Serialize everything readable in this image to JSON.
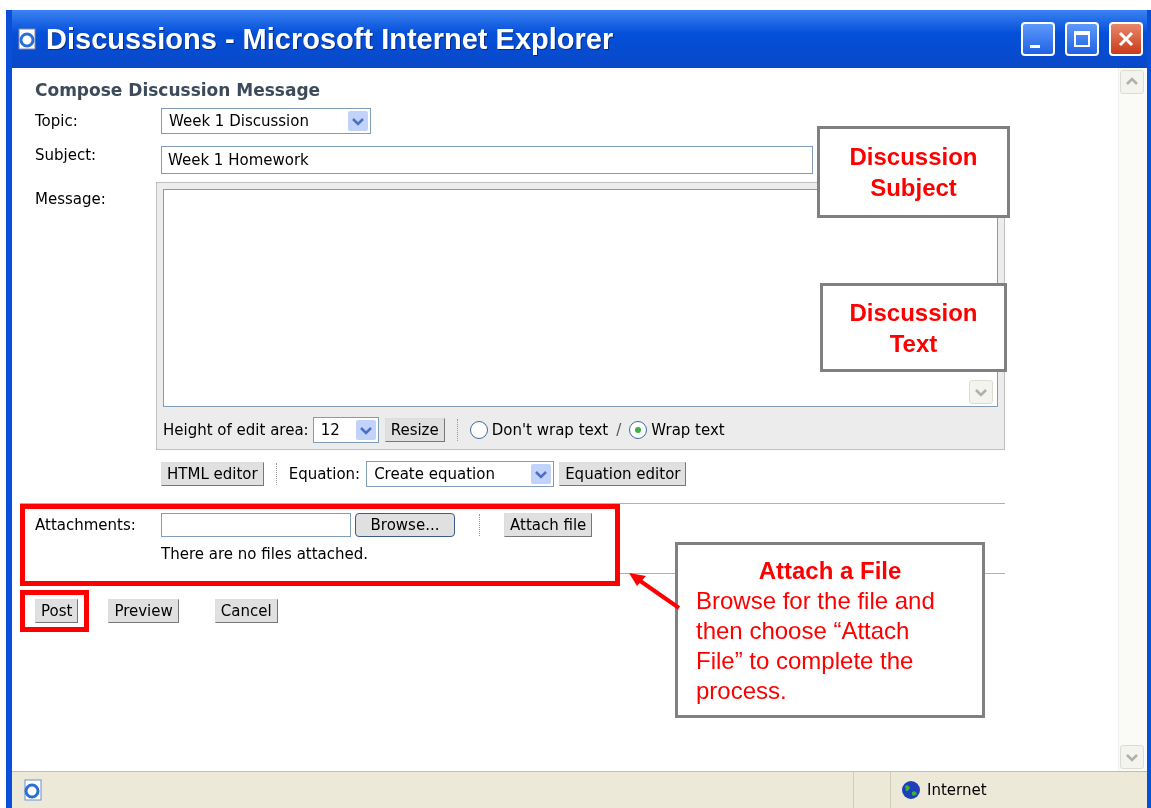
{
  "window": {
    "title": "Discussions - Microsoft Internet Explorer"
  },
  "form": {
    "heading": "Compose Discussion Message",
    "topic": {
      "label": "Topic:",
      "value": "Week 1 Discussion"
    },
    "subject": {
      "label": "Subject:",
      "value": "Week 1 Homework"
    },
    "message": {
      "label": "Message:"
    },
    "editor": {
      "height_label": "Height of edit area:",
      "height_value": "12",
      "resize": "Resize",
      "separator": "/",
      "wrap_options": [
        {
          "label": "Don't wrap text",
          "selected": false
        },
        {
          "label": "Wrap text",
          "selected": true
        }
      ]
    },
    "html_editor": "HTML editor",
    "equation": {
      "label": "Equation:",
      "value": "Create equation",
      "editor": "Equation editor"
    },
    "attachments": {
      "label": "Attachments:",
      "browse": "Browse...",
      "attach": "Attach file",
      "note": "There are no files attached.",
      "highlighted": true
    },
    "buttons": [
      {
        "label": "Post",
        "highlighted": true
      },
      {
        "label": "Preview",
        "highlighted": false
      },
      {
        "label": "Cancel",
        "highlighted": false
      }
    ]
  },
  "status_bar": {
    "zone": "Internet"
  },
  "callouts": [
    {
      "title": "Discussion Subject"
    },
    {
      "title": "Discussion Text"
    },
    {
      "title": "Attach a File",
      "text": "Browse for the file and then choose “Attach File” to complete the process.",
      "arrow": true
    }
  ]
}
